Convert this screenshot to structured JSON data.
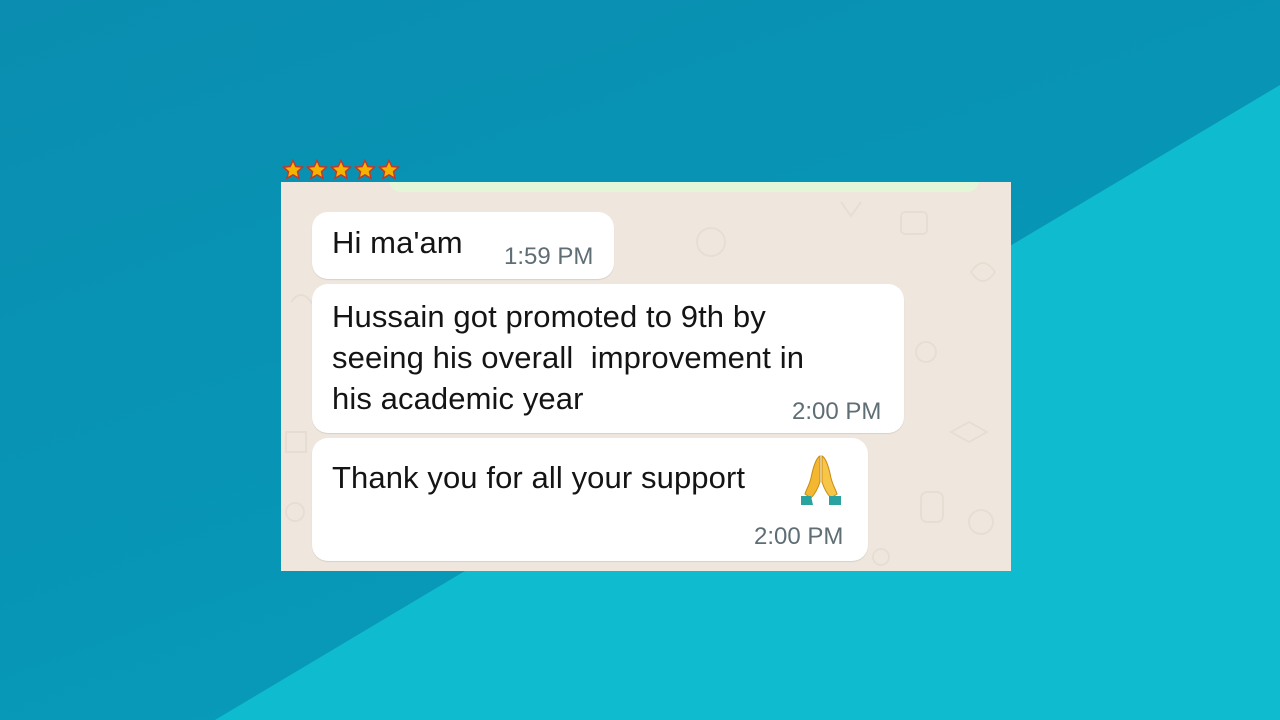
{
  "rating": {
    "stars": 5,
    "max": 5,
    "color": "#f5b301"
  },
  "chat": {
    "messages": [
      {
        "text": "Hi ma'am",
        "time": "1:59 PM"
      },
      {
        "text": "Hussain got promoted to 9th by\nseeing his overall  improvement in\nhis academic year",
        "time": "2:00 PM"
      },
      {
        "text": "Thank you for all your support",
        "time": "2:00 PM",
        "icon": "folded-hands-icon"
      }
    ]
  },
  "colors": {
    "background_dark": "#0796b6",
    "background_light": "#0fbccf",
    "chat_background": "#efe7dd",
    "bubble": "#ffffff",
    "timestamp": "#5f6d75"
  }
}
